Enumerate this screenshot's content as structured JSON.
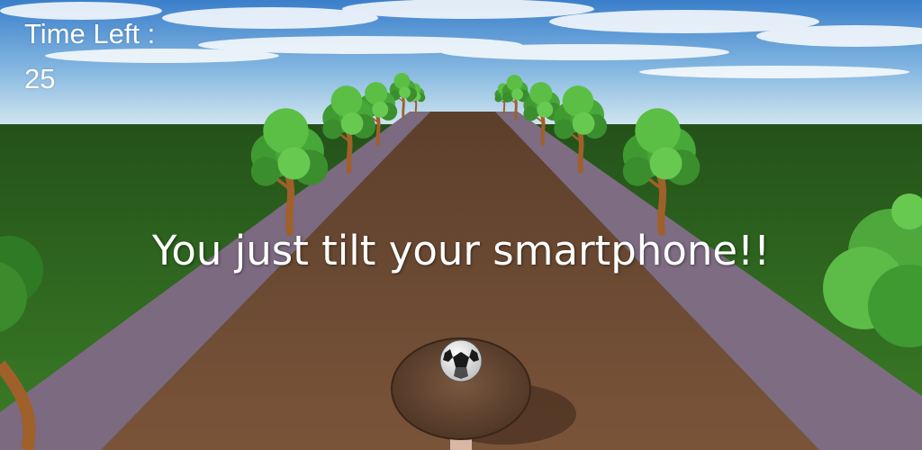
{
  "hud": {
    "time_left_label": "Time Left :",
    "time_left_value": "25"
  },
  "tutorial": {
    "hint_text": "You just tilt your smartphone!!"
  },
  "colors": {
    "sky_top": "#3f86cf",
    "horizon": "#c8e0ee",
    "grass": "#2f6a1f",
    "road": "#6b4b34",
    "curb": "#7d6c80",
    "foliage": "#4aa83a",
    "trunk": "#a8642a",
    "platform_wood": "#6a4a35"
  }
}
